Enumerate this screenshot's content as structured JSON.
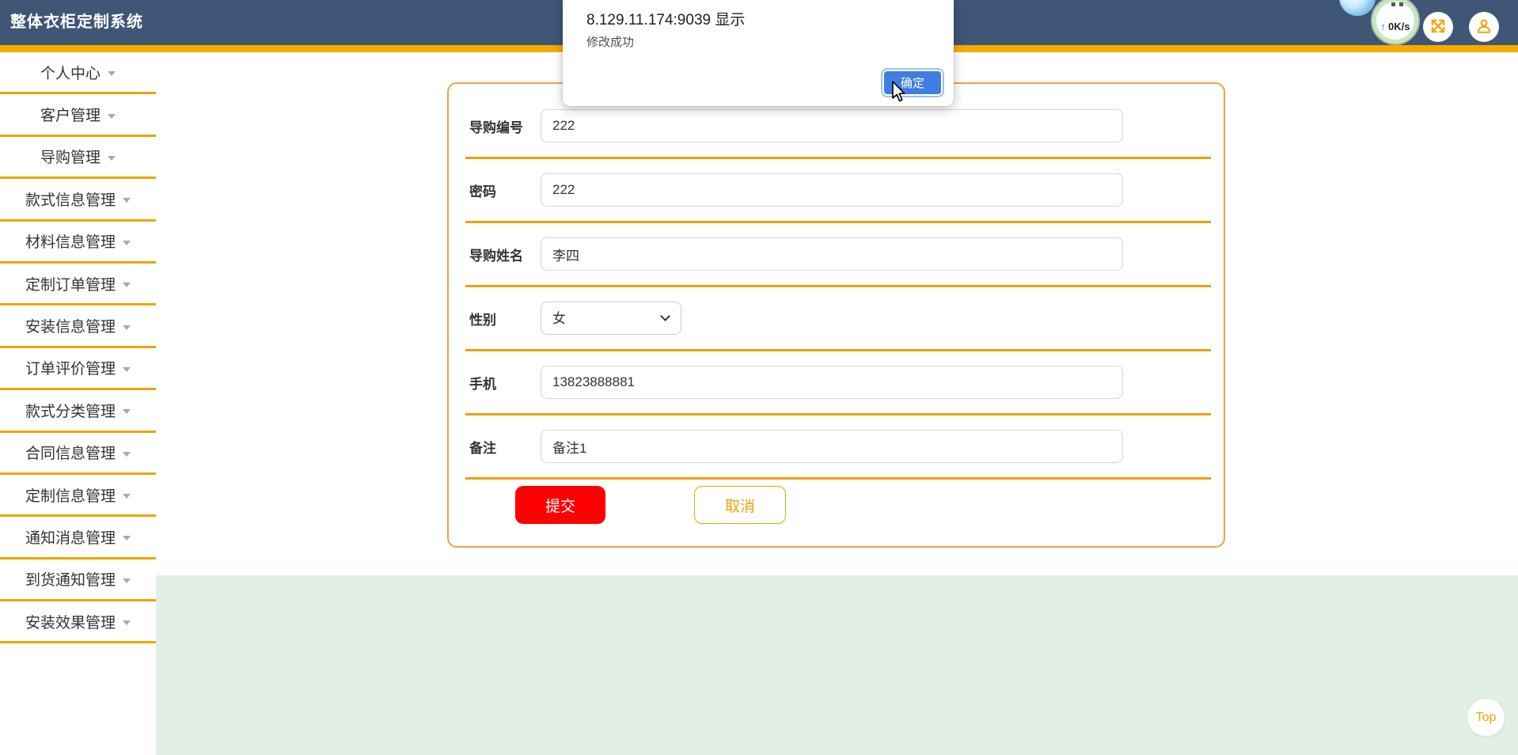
{
  "app": {
    "title": "整体衣柜定制系统"
  },
  "header": {
    "net_widget": {
      "up_arrow": "↑",
      "up_speed": "0K/s"
    }
  },
  "sidebar": {
    "items": [
      {
        "id": "personal-center",
        "label": "个人中心"
      },
      {
        "id": "customer-mgmt",
        "label": "客户管理"
      },
      {
        "id": "guide-mgmt",
        "label": "导购管理"
      },
      {
        "id": "style-info-mgmt",
        "label": "款式信息管理"
      },
      {
        "id": "material-info-mgmt",
        "label": "材料信息管理"
      },
      {
        "id": "custom-order-mgmt",
        "label": "定制订单管理"
      },
      {
        "id": "install-info-mgmt",
        "label": "安装信息管理"
      },
      {
        "id": "order-review-mgmt",
        "label": "订单评价管理"
      },
      {
        "id": "style-category-mgmt",
        "label": "款式分类管理"
      },
      {
        "id": "contract-info-mgmt",
        "label": "合同信息管理"
      },
      {
        "id": "customization-info-mgmt",
        "label": "定制信息管理"
      },
      {
        "id": "notice-message-mgmt",
        "label": "通知消息管理"
      },
      {
        "id": "arrival-notice-mgmt",
        "label": "到货通知管理"
      },
      {
        "id": "install-effect-mgmt",
        "label": "安装效果管理"
      }
    ]
  },
  "dialog": {
    "title": "8.129.11.174:9039 显示",
    "message": "修改成功",
    "ok_label": "确定"
  },
  "form": {
    "fields": [
      {
        "id": "guide-no",
        "label": "导购编号",
        "type": "text",
        "value": "222"
      },
      {
        "id": "password",
        "label": "密码",
        "type": "text",
        "value": "222"
      },
      {
        "id": "guide-name",
        "label": "导购姓名",
        "type": "text",
        "value": "李四"
      },
      {
        "id": "gender",
        "label": "性别",
        "type": "select",
        "value": "女"
      },
      {
        "id": "phone",
        "label": "手机",
        "type": "text",
        "value": "13823888881"
      },
      {
        "id": "remark",
        "label": "备注",
        "type": "text",
        "value": "备注1"
      }
    ],
    "submit_label": "提交",
    "cancel_label": "取消"
  },
  "floating": {
    "top_label": "Top"
  },
  "colors": {
    "accent_orange": "#F0A500",
    "header_blue": "#3F5676",
    "submit_red": "#FE0000",
    "dialog_button_blue": "#3F7EE1",
    "footer_green": "#E2EFE7"
  }
}
